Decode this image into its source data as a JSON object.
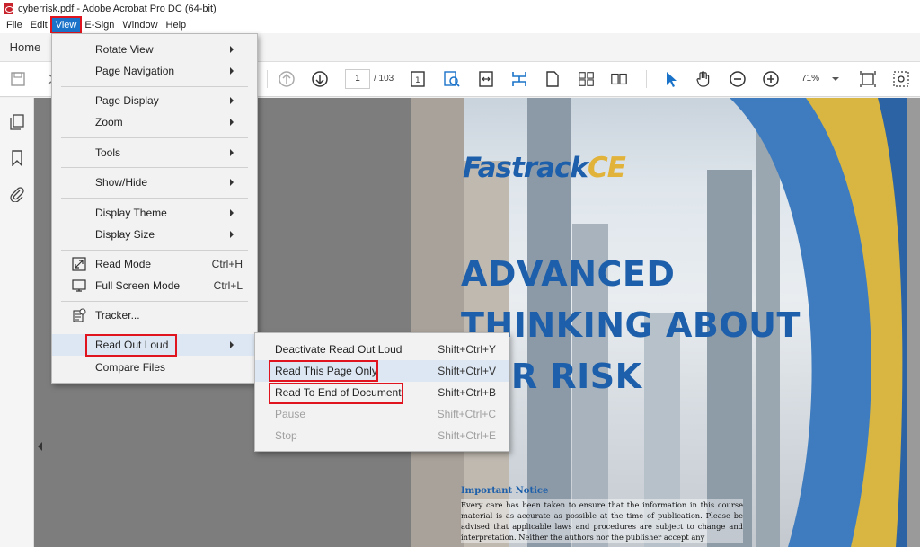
{
  "window": {
    "title": "cyberrisk.pdf - Adobe Acrobat Pro DC (64-bit)"
  },
  "menubar": {
    "items": [
      "File",
      "Edit",
      "View",
      "E-Sign",
      "Window",
      "Help"
    ]
  },
  "tabs": {
    "home": "Home"
  },
  "toolbar": {
    "page_current": "1",
    "page_total": "/ 103",
    "zoom": "71%"
  },
  "view_menu": {
    "items": [
      {
        "label": "Rotate View"
      },
      {
        "label": "Page Navigation"
      },
      {
        "label": "Page Display"
      },
      {
        "label": "Zoom"
      },
      {
        "label": "Tools"
      },
      {
        "label": "Show/Hide"
      },
      {
        "label": "Display Theme"
      },
      {
        "label": "Display Size"
      },
      {
        "label": "Read Mode",
        "shortcut": "Ctrl+H"
      },
      {
        "label": "Full Screen Mode",
        "shortcut": "Ctrl+L"
      },
      {
        "label": "Tracker..."
      },
      {
        "label": "Read Out Loud"
      },
      {
        "label": "Compare Files"
      }
    ]
  },
  "read_out_loud_menu": {
    "items": [
      {
        "label": "Deactivate Read Out Loud",
        "shortcut": "Shift+Ctrl+Y"
      },
      {
        "label": "Read This Page Only",
        "shortcut": "Shift+Ctrl+V"
      },
      {
        "label": "Read To End of Document",
        "shortcut": "Shift+Ctrl+B"
      },
      {
        "label": "Pause",
        "shortcut": "Shift+Ctrl+C"
      },
      {
        "label": "Stop",
        "shortcut": "Shift+Ctrl+E"
      }
    ]
  },
  "document": {
    "logo_main": "Fastrack",
    "logo_ce": "CE",
    "headline_1": "ADVANCED",
    "headline_2": "THINKING ABOUT",
    "headline_3": "BER RISK",
    "notice_title": "Important Notice",
    "notice_body": "Every care has been taken to ensure that the information in this course material is as accurate as possible at the time of publication. Please be advised that applicable laws and procedures are subject to change and interpretation. Neither the authors nor the publisher accept any"
  },
  "colors": {
    "accent": "#1a73c9",
    "highlight": "#e0141e",
    "brand_blue": "#1d5faa",
    "brand_gold": "#e1b33a"
  }
}
